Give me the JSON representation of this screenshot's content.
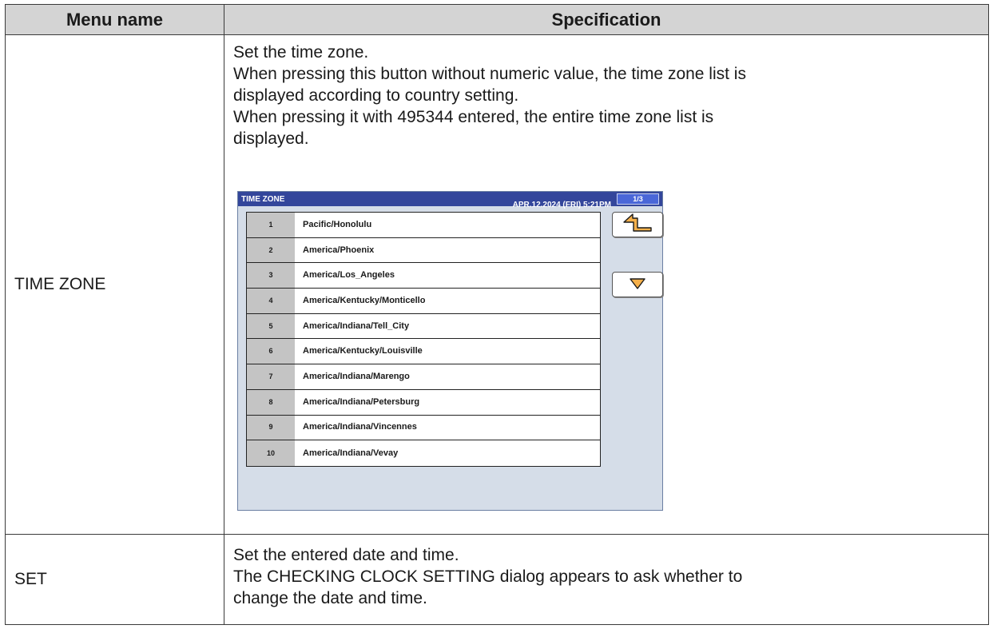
{
  "header": {
    "col1": "Menu name",
    "col2": "Specification"
  },
  "rows": [
    {
      "menu": "TIME ZONE",
      "spec": [
        "Set the time zone.",
        "When pressing this button without numeric value, the time zone list is",
        "displayed according to country setting.",
        "When pressing it with 495344 entered, the entire time zone list is",
        "displayed."
      ]
    },
    {
      "menu": "SET",
      "spec": [
        "Set the entered date and time.",
        "The CHECKING CLOCK SETTING dialog appears to ask whether to",
        "change the date and time."
      ]
    }
  ],
  "screen": {
    "title": "TIME ZONE",
    "datetime": "APR.12.2024 (FRI)   5:21PM",
    "page": "1/3",
    "back_icon": "return-arrow-icon",
    "down_icon": "triangle-down-icon",
    "accent_color": "#33469b",
    "icon_color": "#f5b04a",
    "items": [
      {
        "num": "1",
        "name": "Pacific/Honolulu"
      },
      {
        "num": "2",
        "name": "America/Phoenix"
      },
      {
        "num": "3",
        "name": "America/Los_Angeles"
      },
      {
        "num": "4",
        "name": "America/Kentucky/Monticello"
      },
      {
        "num": "5",
        "name": "America/Indiana/Tell_City"
      },
      {
        "num": "6",
        "name": "America/Kentucky/Louisville"
      },
      {
        "num": "7",
        "name": "America/Indiana/Marengo"
      },
      {
        "num": "8",
        "name": "America/Indiana/Petersburg"
      },
      {
        "num": "9",
        "name": "America/Indiana/Vincennes"
      },
      {
        "num": "10",
        "name": "America/Indiana/Vevay"
      }
    ]
  }
}
